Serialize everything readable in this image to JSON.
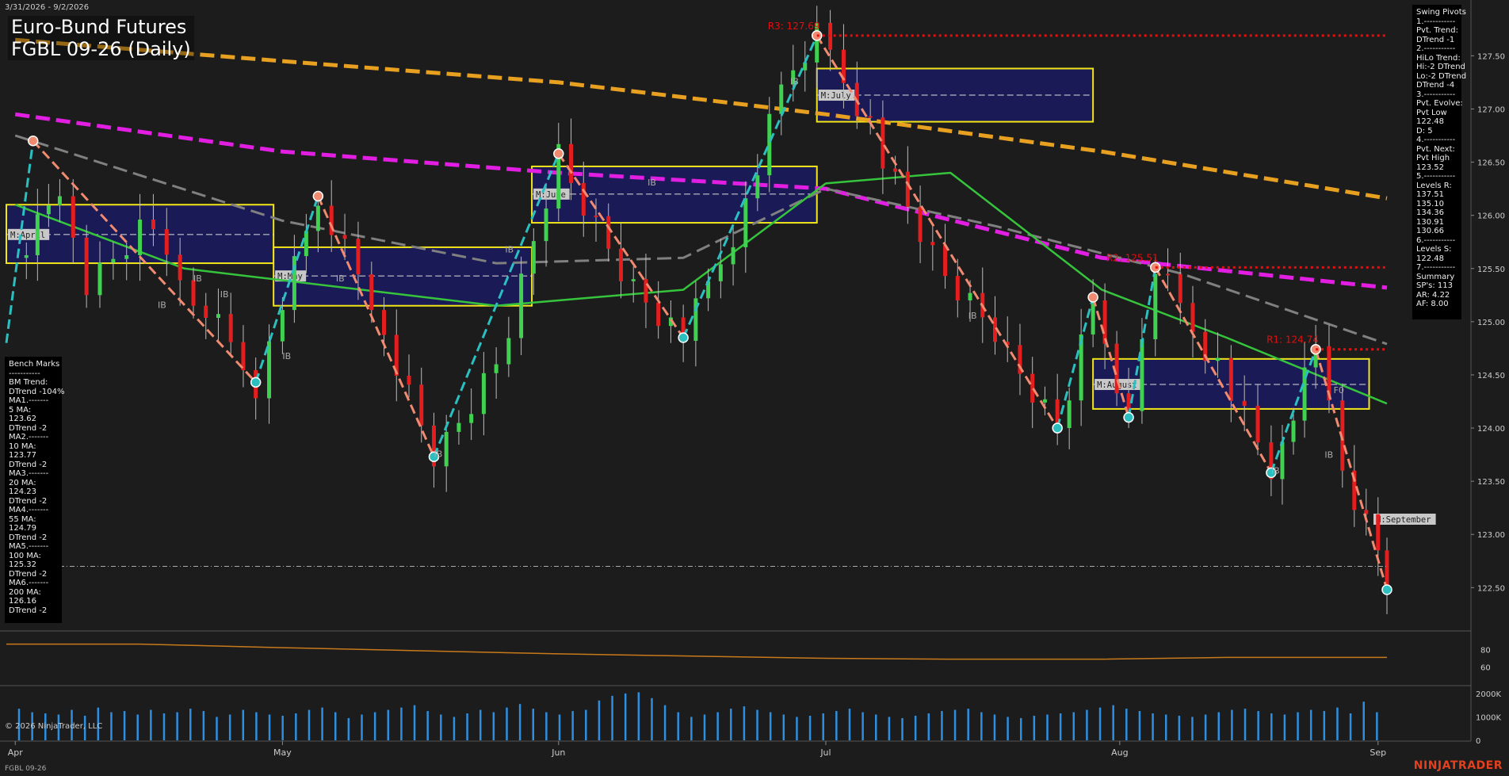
{
  "header": {
    "date_range": "3/31/2026 - 9/2/2026",
    "title_line1": "Euro-Bund Futures",
    "title_line2": "FGBL 09-26 (Daily)"
  },
  "swing_pivots": [
    "Swing Pivots",
    "1.-----------",
    "Pvt. Trend:",
    "DTrend -1",
    "2.-----------",
    "HiLo Trend:",
    "Hi:-2 DTrend",
    "Lo:-2 DTrend",
    "DTrend -4",
    "3.-----------",
    "Pvt. Evolve:",
    "Pvt Low",
    "122.48",
    "D: 5",
    "4.-----------",
    "Pvt. Next:",
    "Pvt High",
    "123.52",
    "5.-----------",
    "Levels R:",
    "137.51",
    "135.10",
    "134.36",
    "130.91",
    "130.66",
    "6.-----------",
    "Levels S:",
    "122.48",
    "7.-----------",
    "Summary",
    "SP's: 113",
    "AR: 4.22",
    "AF: 8.00"
  ],
  "bench_marks": [
    "Bench Marks",
    "-----------",
    "BM Trend:",
    "DTrend -104%",
    "MA1.-------",
    "5 MA:",
    "123.62",
    "DTrend -2",
    "MA2.-------",
    "10 MA:",
    "123.77",
    "DTrend -2",
    "MA3.-------",
    "20 MA:",
    "124.23",
    "DTrend -2",
    "MA4.-------",
    "55 MA:",
    "124.79",
    "DTrend -2",
    "MA5.-------",
    "100 MA:",
    "125.32",
    "DTrend -2",
    "MA6.-------",
    "200 MA:",
    "126.16",
    "DTrend -2"
  ],
  "footer": {
    "copyright": "© 2026 NinjaTrader, LLC",
    "instrument": "FGBL 09-26",
    "brand": "NINJATRADER"
  },
  "colors": {
    "background": "#1c1c1c",
    "up_candle": "#3fd14f",
    "down_candle": "#e41e1e",
    "swing_up": "#2bbfc0",
    "swing_down": "#f08a70",
    "ma_green": "#35c43c",
    "ma_magenta": "#e21ee2",
    "ma_orange": "#e8a020",
    "ma_gray": "#808080",
    "resistance": "#e01010",
    "box_fill": "#1a1a60",
    "box_border": "#f2e61a",
    "volume": "#2d8fe0",
    "osc_line": "#c87a1a"
  },
  "chart_data": {
    "type": "candlestick",
    "x_ticks": [
      {
        "label": "Apr",
        "date": "2026-04-01"
      },
      {
        "label": "May",
        "date": "2026-05-01"
      },
      {
        "label": "Jun",
        "date": "2026-06-01"
      },
      {
        "label": "Jul",
        "date": "2026-07-01"
      },
      {
        "label": "Aug",
        "date": "2026-08-03"
      },
      {
        "label": "Sep",
        "date": "2026-09-01"
      }
    ],
    "y_ticks": [
      "127.50",
      "127.00",
      "126.50",
      "126.00",
      "125.50",
      "125.00",
      "124.50",
      "124.00",
      "123.50",
      "123.00",
      "122.50"
    ],
    "ylim": [
      122.1,
      127.95
    ],
    "xlim": [
      "2026-03-31",
      "2026-09-02"
    ],
    "closes": [
      {
        "date": "2026-04-01",
        "close": 125.6
      },
      {
        "date": "2026-04-06",
        "close": 126.3
      },
      {
        "date": "2026-04-09",
        "close": 125.4
      },
      {
        "date": "2026-04-15",
        "close": 125.9
      },
      {
        "date": "2026-04-21",
        "close": 125.3
      },
      {
        "date": "2026-04-28",
        "close": 124.43
      },
      {
        "date": "2026-05-01",
        "close": 125.2
      },
      {
        "date": "2026-05-05",
        "close": 126.18
      },
      {
        "date": "2026-05-11",
        "close": 125.2
      },
      {
        "date": "2026-05-18",
        "close": 123.73
      },
      {
        "date": "2026-05-25",
        "close": 124.6
      },
      {
        "date": "2026-06-01",
        "close": 126.58
      },
      {
        "date": "2026-06-08",
        "close": 125.5
      },
      {
        "date": "2026-06-15",
        "close": 124.85
      },
      {
        "date": "2026-06-22",
        "close": 126.1
      },
      {
        "date": "2026-06-26",
        "close": 127.2
      },
      {
        "date": "2026-06-30",
        "close": 127.69
      },
      {
        "date": "2026-07-06",
        "close": 126.8
      },
      {
        "date": "2026-07-13",
        "close": 125.6
      },
      {
        "date": "2026-07-20",
        "close": 124.9
      },
      {
        "date": "2026-07-27",
        "close": 124.0
      },
      {
        "date": "2026-07-31",
        "close": 125.23
      },
      {
        "date": "2026-08-04",
        "close": 124.1
      },
      {
        "date": "2026-08-07",
        "close": 125.51
      },
      {
        "date": "2026-08-14",
        "close": 124.6
      },
      {
        "date": "2026-08-20",
        "close": 123.58
      },
      {
        "date": "2026-08-25",
        "close": 124.74
      },
      {
        "date": "2026-08-28",
        "close": 123.6
      },
      {
        "date": "2026-09-01",
        "close": 122.85
      },
      {
        "date": "2026-09-02",
        "close": 122.48
      }
    ],
    "moving_averages": [
      {
        "name": "200 MA",
        "style": "dashed",
        "color": "#e8a020",
        "points": [
          [
            "2026-04-01",
            127.65
          ],
          [
            "2026-05-01",
            127.45
          ],
          [
            "2026-06-01",
            127.25
          ],
          [
            "2026-07-01",
            126.95
          ],
          [
            "2026-08-01",
            126.6
          ],
          [
            "2026-09-02",
            126.16
          ]
        ]
      },
      {
        "name": "100 MA",
        "style": "dashed",
        "color": "#e21ee2",
        "points": [
          [
            "2026-04-01",
            126.95
          ],
          [
            "2026-05-01",
            126.6
          ],
          [
            "2026-06-01",
            126.4
          ],
          [
            "2026-07-01",
            126.25
          ],
          [
            "2026-08-01",
            125.6
          ],
          [
            "2026-09-02",
            125.32
          ]
        ]
      },
      {
        "name": "55 MA",
        "style": "dashed",
        "color": "#808080",
        "points": [
          [
            "2026-04-01",
            126.75
          ],
          [
            "2026-05-01",
            125.95
          ],
          [
            "2026-05-25",
            125.55
          ],
          [
            "2026-06-15",
            125.6
          ],
          [
            "2026-07-01",
            126.25
          ],
          [
            "2026-07-20",
            125.9
          ],
          [
            "2026-08-10",
            125.45
          ],
          [
            "2026-09-02",
            124.79
          ]
        ]
      },
      {
        "name": "20 MA",
        "style": "solid",
        "color": "#35c43c",
        "points": [
          [
            "2026-04-01",
            126.1
          ],
          [
            "2026-04-20",
            125.5
          ],
          [
            "2026-05-10",
            125.3
          ],
          [
            "2026-05-25",
            125.15
          ],
          [
            "2026-06-15",
            125.3
          ],
          [
            "2026-07-01",
            126.3
          ],
          [
            "2026-07-15",
            126.4
          ],
          [
            "2026-08-01",
            125.3
          ],
          [
            "2026-08-15",
            124.85
          ],
          [
            "2026-09-02",
            124.23
          ]
        ]
      }
    ],
    "swing_legs": [
      {
        "dir": "up",
        "from": [
          "2026-03-31",
          124.8
        ],
        "to": [
          "2026-04-03",
          126.7
        ]
      },
      {
        "dir": "down",
        "from": [
          "2026-04-03",
          126.7
        ],
        "to": [
          "2026-04-28",
          124.43
        ]
      },
      {
        "dir": "up",
        "from": [
          "2026-04-28",
          124.43
        ],
        "to": [
          "2026-05-05",
          126.18
        ]
      },
      {
        "dir": "down",
        "from": [
          "2026-05-05",
          126.18
        ],
        "to": [
          "2026-05-18",
          123.73
        ]
      },
      {
        "dir": "up",
        "from": [
          "2026-05-18",
          123.73
        ],
        "to": [
          "2026-06-01",
          126.58
        ]
      },
      {
        "dir": "down",
        "from": [
          "2026-06-01",
          126.58
        ],
        "to": [
          "2026-06-15",
          124.85
        ]
      },
      {
        "dir": "up",
        "from": [
          "2026-06-15",
          124.85
        ],
        "to": [
          "2026-06-30",
          127.69
        ]
      },
      {
        "dir": "down",
        "from": [
          "2026-06-30",
          127.69
        ],
        "to": [
          "2026-07-27",
          124.0
        ]
      },
      {
        "dir": "up",
        "from": [
          "2026-07-27",
          124.0
        ],
        "to": [
          "2026-07-31",
          125.23
        ]
      },
      {
        "dir": "down",
        "from": [
          "2026-07-31",
          125.23
        ],
        "to": [
          "2026-08-04",
          124.1
        ]
      },
      {
        "dir": "up",
        "from": [
          "2026-08-04",
          124.1
        ],
        "to": [
          "2026-08-07",
          125.51
        ]
      },
      {
        "dir": "down",
        "from": [
          "2026-08-07",
          125.51
        ],
        "to": [
          "2026-08-20",
          123.58
        ]
      },
      {
        "dir": "up",
        "from": [
          "2026-08-20",
          123.58
        ],
        "to": [
          "2026-08-25",
          124.74
        ]
      },
      {
        "dir": "down",
        "from": [
          "2026-08-25",
          124.74
        ],
        "to": [
          "2026-09-02",
          122.48
        ]
      }
    ],
    "resistance_lines": [
      {
        "label": "R3: 127.69",
        "value": 127.69,
        "from": "2026-06-30"
      },
      {
        "label": "R2: 125.51",
        "value": 125.51,
        "from": "2026-08-07"
      },
      {
        "label": "R1: 124.74",
        "value": 124.74,
        "from": "2026-08-25"
      }
    ],
    "monthly_boxes": [
      {
        "label": "M:April",
        "from": "2026-03-31",
        "to": "2026-04-30",
        "top": 126.1,
        "bottom": 125.55,
        "mid": 125.82
      },
      {
        "label": "M:May",
        "from": "2026-04-30",
        "to": "2026-05-29",
        "top": 125.7,
        "bottom": 125.15,
        "mid": 125.43
      },
      {
        "label": "M:June",
        "from": "2026-05-29",
        "to": "2026-06-30",
        "top": 126.46,
        "bottom": 125.93,
        "mid": 126.2
      },
      {
        "label": "M:July",
        "from": "2026-06-30",
        "to": "2026-07-31",
        "top": 127.38,
        "bottom": 126.88,
        "mid": 127.13
      },
      {
        "label": "M:August",
        "from": "2026-07-31",
        "to": "2026-08-31",
        "top": 124.65,
        "bottom": 124.18,
        "mid": 124.41
      },
      {
        "label": "M:September",
        "from": "2026-09-01",
        "to": "2026-09-02",
        "top": null,
        "bottom": null,
        "mid": null
      }
    ],
    "annotations": [
      {
        "text": "IB",
        "date": "2026-04-17",
        "value": 125.13
      },
      {
        "text": "IB",
        "date": "2026-04-21",
        "value": 125.38
      },
      {
        "text": "IB",
        "date": "2026-04-24",
        "value": 125.23
      },
      {
        "text": "IB",
        "date": "2026-05-01",
        "value": 124.65
      },
      {
        "text": "IB",
        "date": "2026-05-07",
        "value": 125.38
      },
      {
        "text": "IB",
        "date": "2026-05-18",
        "value": 123.73
      },
      {
        "text": "IB",
        "date": "2026-05-26",
        "value": 125.65
      },
      {
        "text": "IB",
        "date": "2026-06-11",
        "value": 126.28
      },
      {
        "text": "IB",
        "date": "2026-06-27",
        "value": 127.23
      },
      {
        "text": "IB",
        "date": "2026-07-17",
        "value": 125.03
      },
      {
        "text": "IB",
        "date": "2026-08-20",
        "value": 123.57
      },
      {
        "text": "IB",
        "date": "2026-08-26",
        "value": 123.72
      },
      {
        "text": "F0",
        "date": "2026-08-27",
        "value": 124.33
      }
    ],
    "last_price": 122.7,
    "oscillator": {
      "y_ticks": [
        "80",
        "60"
      ],
      "ylim": [
        40,
        100
      ],
      "points": [
        [
          "2026-03-31",
          86
        ],
        [
          "2026-04-15",
          86
        ],
        [
          "2026-05-01",
          82
        ],
        [
          "2026-06-01",
          75
        ],
        [
          "2026-07-01",
          70
        ],
        [
          "2026-07-15",
          69
        ],
        [
          "2026-08-01",
          69
        ],
        [
          "2026-08-15",
          71
        ],
        [
          "2026-09-02",
          71
        ]
      ]
    },
    "volume": {
      "y_ticks": [
        "2000K",
        "1000K",
        "0"
      ],
      "ylim": [
        0,
        2300
      ],
      "values": [
        1350,
        1200,
        1150,
        1100,
        1300,
        1050,
        1400,
        1200,
        1250,
        1100,
        1300,
        1150,
        1200,
        1350,
        1250,
        1000,
        1100,
        1300,
        1200,
        1100,
        1050,
        1150,
        1300,
        1400,
        1200,
        950,
        1100,
        1200,
        1300,
        1400,
        1500,
        1250,
        1100,
        1000,
        1150,
        1300,
        1200,
        1400,
        1550,
        1350,
        1200,
        1100,
        1250,
        1300,
        1700,
        1900,
        2000,
        2050,
        1800,
        1500,
        1200,
        1000,
        1100,
        1200,
        1350,
        1450,
        1300,
        1200,
        1100,
        1000,
        1050,
        1150,
        1250,
        1350,
        1200,
        1100,
        1000,
        950,
        1050,
        1150,
        1250,
        1300,
        1350,
        1200,
        1100,
        1000,
        950,
        1050,
        1100,
        1150,
        1200,
        1300,
        1400,
        1500,
        1350,
        1250,
        1150,
        1100,
        1050,
        1000,
        1100,
        1200,
        1300,
        1350,
        1250,
        1150,
        1100,
        1200,
        1300,
        1250,
        1400,
        1150,
        1650,
        1200
      ]
    }
  }
}
